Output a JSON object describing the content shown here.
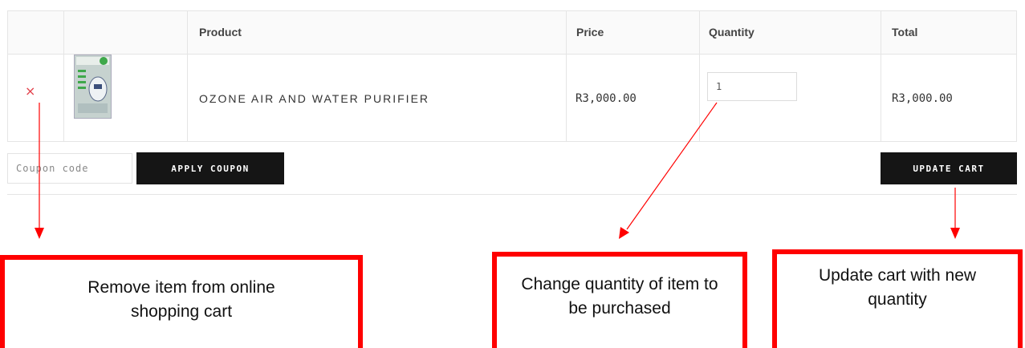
{
  "table": {
    "headers": {
      "product": "Product",
      "price": "Price",
      "quantity": "Quantity",
      "total": "Total"
    },
    "rows": [
      {
        "remove_symbol": "×",
        "product_name": "OZONE AIR AND WATER PURIFIER",
        "price": "R3,000.00",
        "quantity": "1",
        "total": "R3,000.00"
      }
    ]
  },
  "coupon": {
    "placeholder": "Coupon code",
    "apply_label": "APPLY COUPON"
  },
  "update_label": "UPDATE CART",
  "callouts": {
    "remove": "Remove item from online shopping cart",
    "quantity": "Change quantity of item to be purchased",
    "update": "Update cart with new quantity"
  },
  "colors": {
    "accent_red": "#ff0000",
    "remove_red": "#e2404a",
    "button_dark": "#151515"
  }
}
